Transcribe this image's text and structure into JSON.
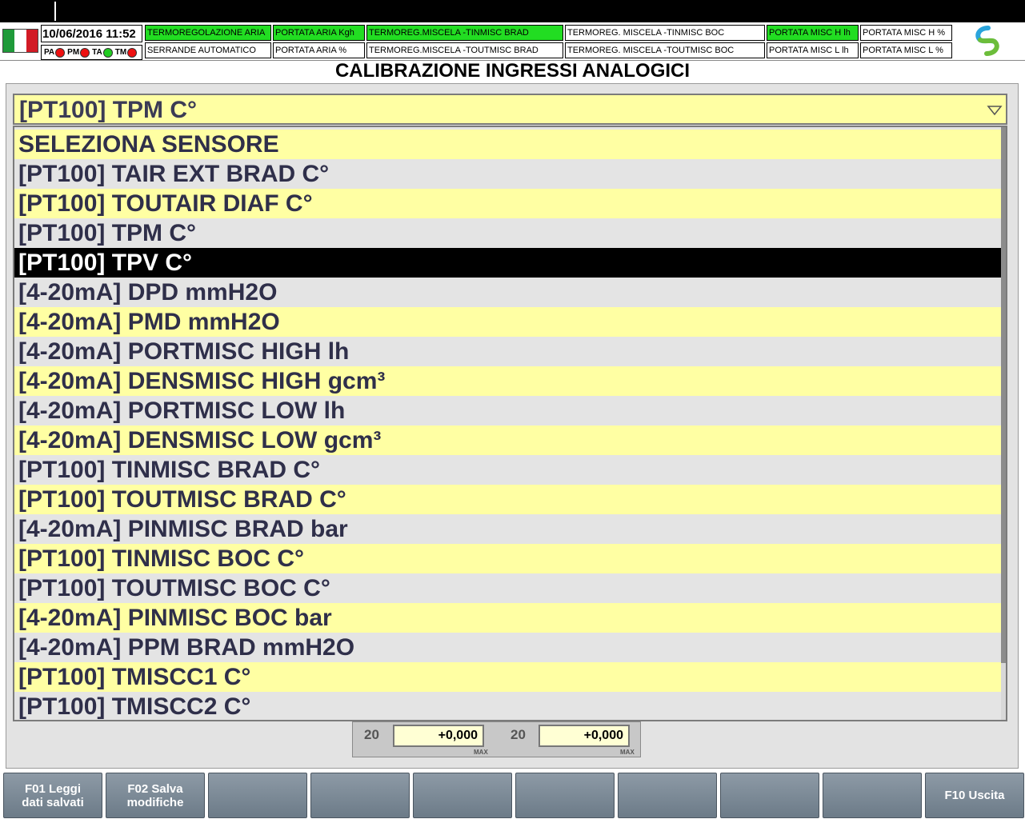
{
  "header": {
    "datetime": "10/06/2016 11:52",
    "leds": [
      {
        "label": "PA",
        "color": "#ee1111"
      },
      {
        "label": "PM",
        "color": "#ee1111"
      },
      {
        "label": "TA",
        "color": "#22cc22"
      },
      {
        "label": "TM",
        "color": "#ee1111"
      }
    ],
    "flag_colors": [
      "#1f9a3a",
      "#ffffff",
      "#d21b25"
    ],
    "status_cells": [
      {
        "label": "TERMOREGOLAZIONE ARIA",
        "active": true
      },
      {
        "label": "SERRANDE AUTOMATICO",
        "active": false
      },
      {
        "label": "PORTATA ARIA Kgh",
        "active": true
      },
      {
        "label": "PORTATA ARIA %",
        "active": false
      },
      {
        "label": "TERMOREG.MISCELA -TINMISC BRAD",
        "active": true
      },
      {
        "label": "TERMOREG.MISCELA -TOUTMISC BRAD",
        "active": false
      },
      {
        "label": "TERMOREG. MISCELA -TINMISC BOC",
        "active": false
      },
      {
        "label": "TERMOREG. MISCELA -TOUTMISC BOC",
        "active": false
      },
      {
        "label": "PORTATA MISC H lh",
        "active": true
      },
      {
        "label": "PORTATA MISC L lh",
        "active": false
      },
      {
        "label": "PORTATA MISC H %",
        "active": false
      },
      {
        "label": "PORTATA MISC L %",
        "active": false
      }
    ]
  },
  "page_title": "CALIBRAZIONE INGRESSI ANALOGICI",
  "sensor_select": {
    "selected": "[PT100] TPM C°",
    "highlighted_index": 4,
    "options": [
      "SELEZIONA SENSORE",
      "[PT100] TAIR EXT BRAD C°",
      "[PT100] TOUTAIR DIAF C°",
      "[PT100] TPM C°",
      "[PT100] TPV C°",
      "[4-20mA] DPD mmH2O",
      "[4-20mA] PMD mmH2O",
      "[4-20mA] PORTMISC HIGH lh",
      "[4-20mA] DENSMISC HIGH gcm³",
      "[4-20mA] PORTMISC LOW lh",
      "[4-20mA] DENSMISC LOW gcm³",
      "[PT100] TINMISC BRAD C°",
      "[PT100] TOUTMISC BRAD C°",
      "[4-20mA] PINMISC BRAD bar",
      "[PT100] TINMISC BOC C°",
      "[PT100] TOUTMISC BOC C°",
      "[4-20mA] PINMISC BOC bar",
      "[4-20mA] PPM BRAD mmH2O",
      "[PT100] TMISCC1 C°",
      "[PT100] TMISCC2 C°"
    ]
  },
  "calibration": {
    "left_num": "20",
    "left_value": "+0,000",
    "left_max": "MAX",
    "right_num": "20",
    "right_value": "+0,000",
    "right_max": "MAX"
  },
  "function_keys": [
    "F01 Leggi\ndati salvati",
    "F02 Salva\nmodifiche",
    "",
    "",
    "",
    "",
    "",
    "",
    "",
    "F10 Uscita"
  ],
  "colors": {
    "active_cell": "#22dd22",
    "list_yellow": "#ffffa3",
    "list_gray": "#e4e4e4",
    "selected_row": "#000000"
  }
}
